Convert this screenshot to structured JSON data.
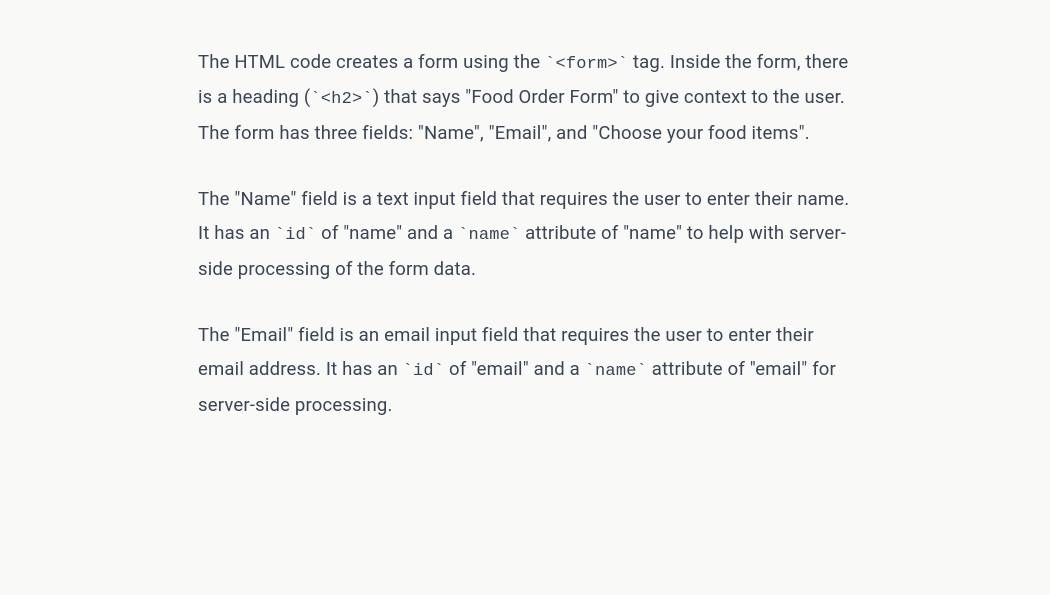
{
  "paragraphs": {
    "p1": {
      "s1a": "The HTML code creates a form using the ",
      "code1": "<form>",
      "s1b": " tag. Inside the form, there is a heading (",
      "code2": "<h2>",
      "s1c": ") that says \"Food Order Form\" to give context to the user. The form has three fields: \"Name\", \"Email\", and \"Choose your food items\"."
    },
    "p2": {
      "s1a": "The \"Name\" field is a text input field that requires the user to enter their name. It has an ",
      "code1": "id",
      "s1b": " of \"name\" and a ",
      "code2": "name",
      "s1c": " attribute of \"name\" to help with server-side processing of the form data."
    },
    "p3": {
      "s1a": "The \"Email\" field is an email input field that requires the user to enter their email address. It has an ",
      "code1": "id",
      "s1b": " of \"email\" and a ",
      "code2": "name",
      "s1c": " attribute of \"email\" for server-side processing."
    }
  }
}
